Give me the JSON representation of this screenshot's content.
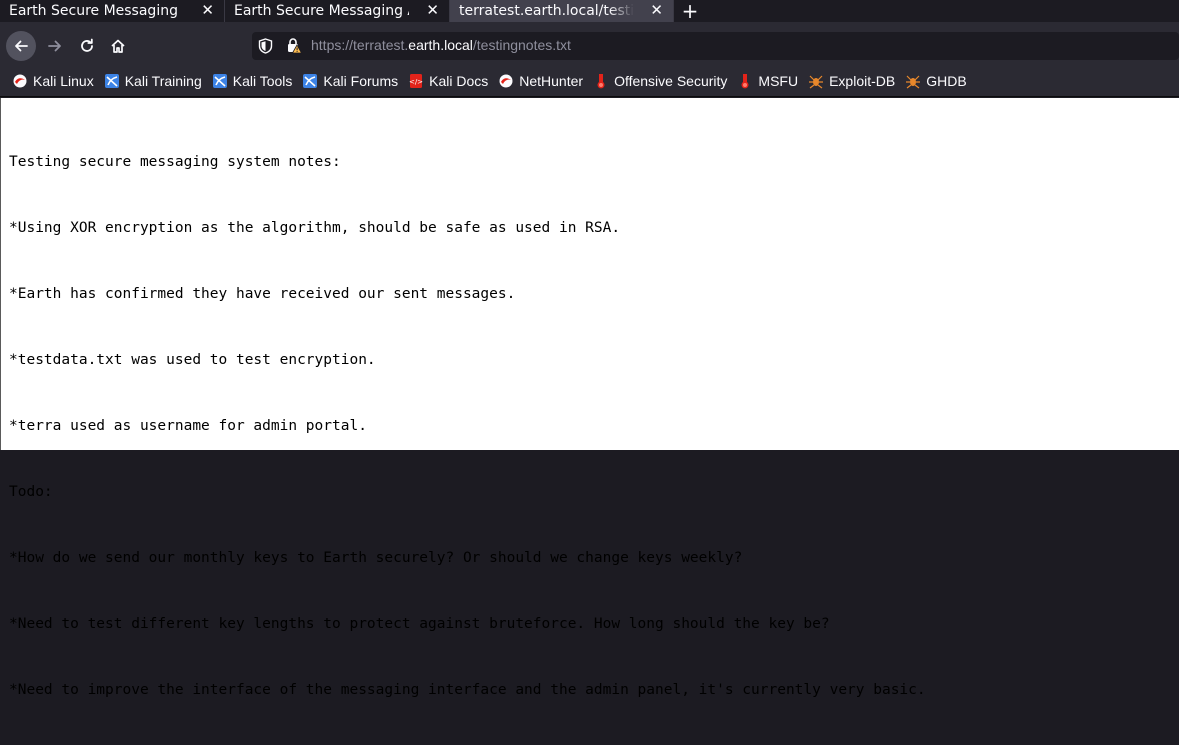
{
  "browser": {
    "tabs": [
      {
        "title": "Earth Secure Messaging",
        "active": false
      },
      {
        "title": "Earth Secure Messaging Admin",
        "active": false
      },
      {
        "title": "terratest.earth.local/testingnotes.txt",
        "active": true
      }
    ],
    "new_tab_label": "+",
    "close_label": "✕",
    "url": {
      "scheme": "https://",
      "sub": "terratest.",
      "host": "earth.local",
      "path": "/testingnotes.txt"
    },
    "bookmarks": [
      {
        "label": "Kali Linux",
        "icon": "kali-dragon-icon"
      },
      {
        "label": "Kali Training",
        "icon": "kali-training-icon"
      },
      {
        "label": "Kali Tools",
        "icon": "kali-tools-icon"
      },
      {
        "label": "Kali Forums",
        "icon": "kali-forums-icon"
      },
      {
        "label": "Kali Docs",
        "icon": "kali-docs-icon"
      },
      {
        "label": "NetHunter",
        "icon": "nethunter-icon"
      },
      {
        "label": "Offensive Security",
        "icon": "offsec-icon"
      },
      {
        "label": "MSFU",
        "icon": "msfu-icon"
      },
      {
        "label": "Exploit-DB",
        "icon": "exploitdb-icon"
      },
      {
        "label": "GHDB",
        "icon": "ghdb-icon"
      }
    ]
  },
  "document": {
    "lines": [
      "Testing secure messaging system notes:",
      "*Using XOR encryption as the algorithm, should be safe as used in RSA.",
      "*Earth has confirmed they have received our sent messages.",
      "*testdata.txt was used to test encryption.",
      "*terra used as username for admin portal.",
      "Todo:",
      "*How do we send our monthly keys to Earth securely? Or should we change keys weekly?",
      "*Need to test different key lengths to protect against bruteforce. How long should the key be?",
      "*Need to improve the interface of the messaging interface and the admin panel, it's currently very basic."
    ]
  },
  "colors": {
    "chrome_dark": "#1c1b22",
    "toolbar": "#2b2a33",
    "active_tab": "#42414d",
    "page_bg": "#ffffff"
  }
}
